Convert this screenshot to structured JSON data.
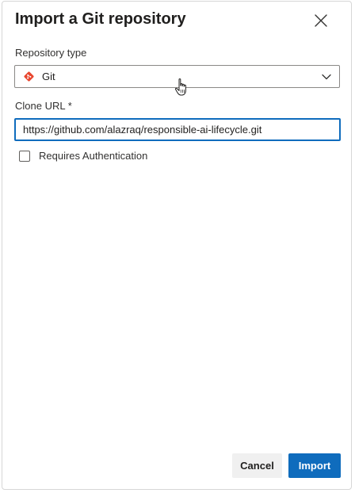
{
  "dialog": {
    "title": "Import a Git repository",
    "close_icon": "close-icon"
  },
  "repository_type": {
    "label": "Repository type",
    "selected_value": "Git",
    "icon": "git-logo-icon",
    "icon_color": "#e8472f",
    "expand_icon": "chevron-down-icon"
  },
  "clone_url": {
    "label": "Clone URL *",
    "value": "https://github.com/alazraq/responsible-ai-lifecycle.git",
    "focus_color": "#0f6cbd"
  },
  "authentication": {
    "label": "Requires Authentication",
    "checked": false
  },
  "footer": {
    "cancel_label": "Cancel",
    "import_label": "Import",
    "primary_color": "#0f6cbd"
  },
  "pointer": {
    "icon": "hand-pointer-icon"
  }
}
